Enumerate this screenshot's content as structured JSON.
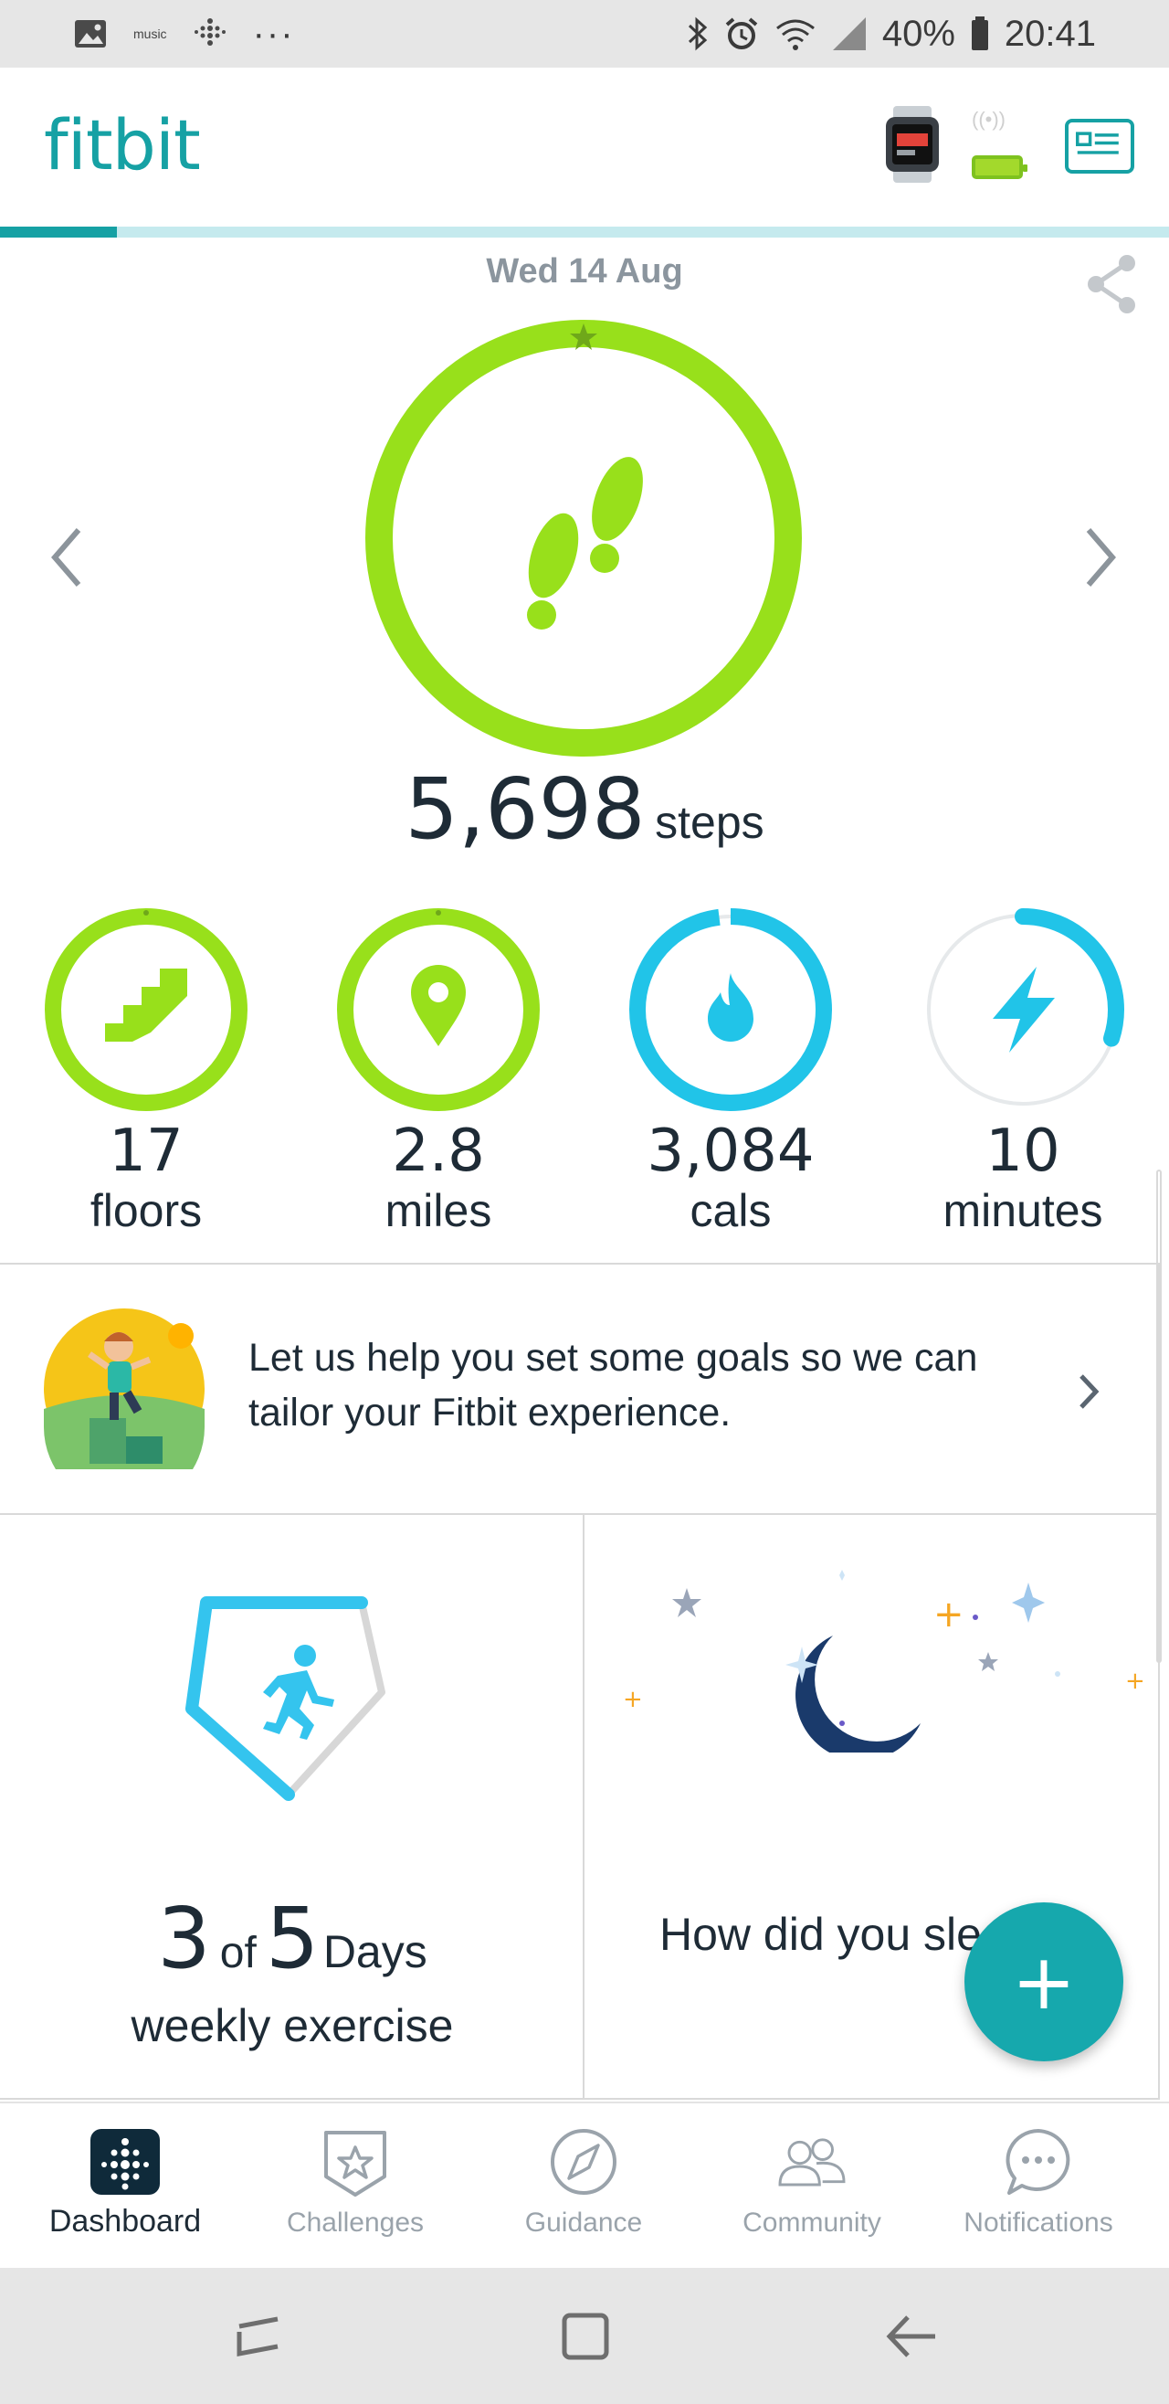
{
  "status_bar": {
    "music_label": "music",
    "battery_percent": "40%",
    "time": "20:41"
  },
  "app": {
    "logo": "fitbit",
    "sync_progress_fraction": 0.1
  },
  "dashboard": {
    "date": "Wed 14 Aug",
    "steps": {
      "value": "5,698",
      "unit": "steps"
    },
    "stats": [
      {
        "id": "floors",
        "value": "17",
        "unit": "floors",
        "icon": "stairs-icon",
        "color": "#98e01b",
        "goal_fraction": 1.0
      },
      {
        "id": "miles",
        "value": "2.8",
        "unit": "miles",
        "icon": "location-pin-icon",
        "color": "#98e01b",
        "goal_fraction": 1.0
      },
      {
        "id": "cals",
        "value": "3,084",
        "unit": "cals",
        "icon": "flame-icon",
        "color": "#21c4e8",
        "goal_fraction": 0.98
      },
      {
        "id": "minutes",
        "value": "10",
        "unit": "minutes",
        "icon": "lightning-icon",
        "color": "#21c4e8",
        "goal_fraction": 0.3
      }
    ],
    "goals_card": {
      "text": "Let us help you set some goals so we can tailor your Fitbit experience."
    },
    "exercise_tile": {
      "count": "3",
      "of": "of",
      "target": "5",
      "unit": "Days",
      "caption": "weekly exercise"
    },
    "sleep_tile": {
      "text": "How did you sleep?"
    },
    "fab_label": "+"
  },
  "bottom_nav": [
    {
      "label": "Dashboard",
      "icon": "dashboard-icon",
      "active": true
    },
    {
      "label": "Challenges",
      "icon": "star-badge-icon",
      "active": false
    },
    {
      "label": "Guidance",
      "icon": "compass-icon",
      "active": false
    },
    {
      "label": "Community",
      "icon": "people-icon",
      "active": false
    },
    {
      "label": "Notifications",
      "icon": "chat-bubble-icon",
      "active": false
    }
  ],
  "colors": {
    "brand": "#16a1a4",
    "steps_green": "#98e01b",
    "active_blue": "#21c4e8",
    "text_dark": "#1e2b36"
  }
}
